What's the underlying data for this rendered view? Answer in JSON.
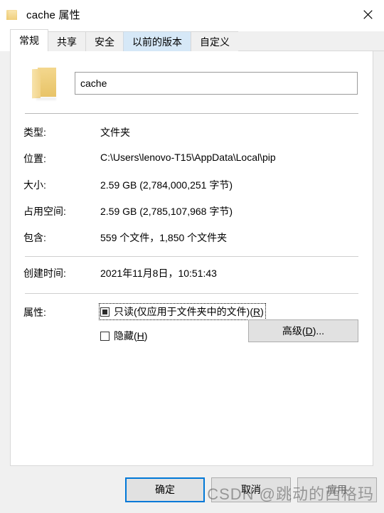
{
  "window": {
    "title": "cache 属性",
    "icon": "folder-icon",
    "close_label": "×"
  },
  "tabs": [
    {
      "label": "常规",
      "state": "active"
    },
    {
      "label": "共享",
      "state": "normal"
    },
    {
      "label": "安全",
      "state": "normal"
    },
    {
      "label": "以前的版本",
      "state": "hover"
    },
    {
      "label": "自定义",
      "state": "normal"
    }
  ],
  "general": {
    "folder_icon": "folder-icon",
    "name_value": "cache",
    "name_placeholder": "",
    "rows": [
      {
        "label": "类型:",
        "value": "文件夹"
      },
      {
        "label": "位置:",
        "value": "C:\\Users\\lenovo-T15\\AppData\\Local\\pip"
      },
      {
        "label": "大小:",
        "value": "2.59 GB (2,784,000,251 字节)"
      },
      {
        "label": "占用空间:",
        "value": "2.59 GB (2,785,107,968 字节)"
      },
      {
        "label": "包含:",
        "value": "559 个文件，1,850 个文件夹"
      }
    ],
    "created": {
      "label": "创建时间:",
      "value": "2021年11月8日，10:51:43"
    },
    "attributes": {
      "label": "属性:",
      "readonly": {
        "text_before": "只读(仅应用于文件夹中的文件)(",
        "accel": "R",
        "text_after": ")",
        "state": "indeterminate",
        "focused": true
      },
      "hidden": {
        "text_before": "隐藏(",
        "accel": "H",
        "text_after": ")",
        "state": "unchecked",
        "focused": false
      },
      "advanced_button": {
        "text_before": "高级(",
        "accel": "D",
        "text_after": ")..."
      }
    }
  },
  "footer": {
    "ok": "确定",
    "cancel": "取消",
    "apply": "应用"
  },
  "watermark": {
    "text": "CSDN @跳动的西格玛"
  },
  "colors": {
    "accent": "#0078d7",
    "tab_hover": "#d6e8f7",
    "dialog_bg": "#f0f0f0",
    "panel_bg": "#ffffff",
    "folder_yellow": "#eecb73"
  }
}
